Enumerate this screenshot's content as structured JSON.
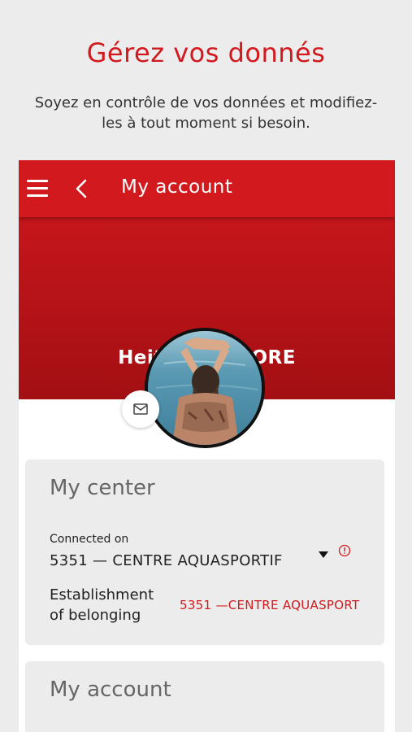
{
  "promo": {
    "title": "Gérez vos donnés",
    "subtitle": "Soyez en contrôle de vos données et modifiez-les à tout moment si besoin."
  },
  "appbar": {
    "title": "My account",
    "menu_icon": "hamburger-menu-icon",
    "back_icon": "chevron-left-icon"
  },
  "profile": {
    "name": "Heitz  APPSTORE",
    "mail_icon": "envelope-icon"
  },
  "center_card": {
    "title": "My center",
    "connected_label": "Connected on",
    "connected_value": "5351 — CENTRE AQUASPORTIF",
    "establishment_label": "Establishment of belonging",
    "establishment_value": "5351 —CENTRE AQUASPORTIF"
  },
  "account_card": {
    "title": "My account"
  },
  "colors": {
    "brand_red": "#d2191e",
    "background": "#ececec"
  }
}
